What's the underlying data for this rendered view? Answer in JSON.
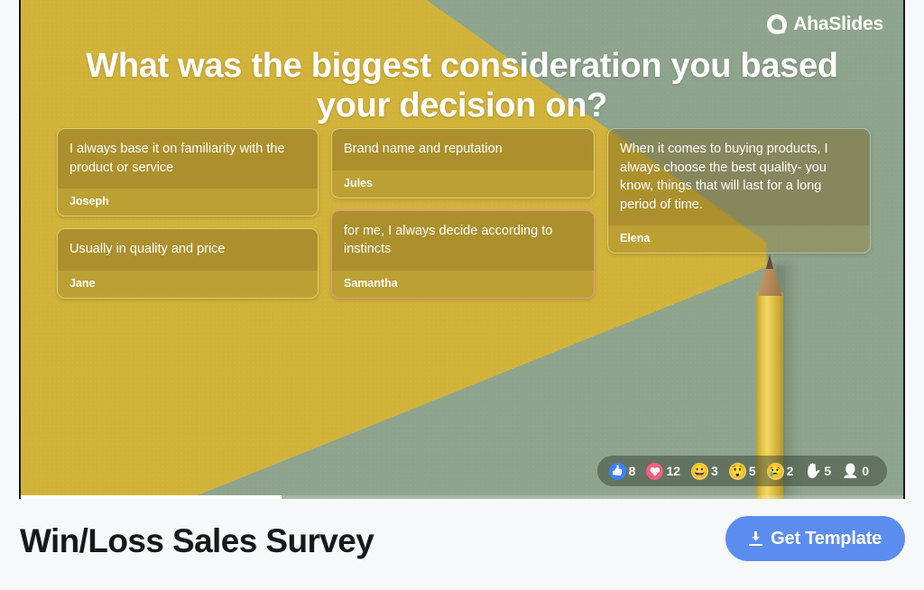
{
  "slide": {
    "logo_text": "AhaSlides",
    "logo_icon": "ahaslides-logo-icon",
    "question": "What was the biggest consideration you based your decision on?",
    "columns": [
      {
        "cards": [
          {
            "text": "I always base it on familiarity with the product or service",
            "author": "Joseph",
            "highlighted": false
          },
          {
            "text": "Usually in quality and price",
            "author": "Jane",
            "highlighted": false
          }
        ]
      },
      {
        "cards": [
          {
            "text": "Brand name and reputation",
            "author": "Jules",
            "highlighted": false
          },
          {
            "text": "for me, I always decide according to instincts",
            "author": "Samantha",
            "highlighted": true
          }
        ]
      },
      {
        "cards": [
          {
            "text": "When it comes to buying products, I always choose the best quality- you know, things that will last for a long period of time.",
            "author": "Elena",
            "highlighted": false
          }
        ]
      }
    ],
    "reactions": [
      {
        "icon": "thumbs-up-icon",
        "glyph": "👍",
        "count": "8"
      },
      {
        "icon": "heart-icon",
        "glyph": "❤",
        "count": "12"
      },
      {
        "icon": "grinning-face-icon",
        "glyph": "😀",
        "count": "3"
      },
      {
        "icon": "astonished-face-icon",
        "glyph": "😲",
        "count": "5"
      },
      {
        "icon": "crying-face-icon",
        "glyph": "😢",
        "count": "2"
      },
      {
        "icon": "raised-hand-icon",
        "glyph": "✋",
        "count": "5"
      },
      {
        "icon": "person-icon",
        "glyph": "👤",
        "count": "0"
      }
    ],
    "colors": {
      "background_green": "#8FA48C",
      "wedge_yellow": "#D2B33B",
      "highlight_border": "#E98FA0",
      "card_text": "#FFFFFF"
    }
  },
  "footer": {
    "title": "Win/Loss Sales Survey",
    "cta_label": "Get Template",
    "cta_icon": "download-icon",
    "cta_color": "#5B8DEF"
  }
}
